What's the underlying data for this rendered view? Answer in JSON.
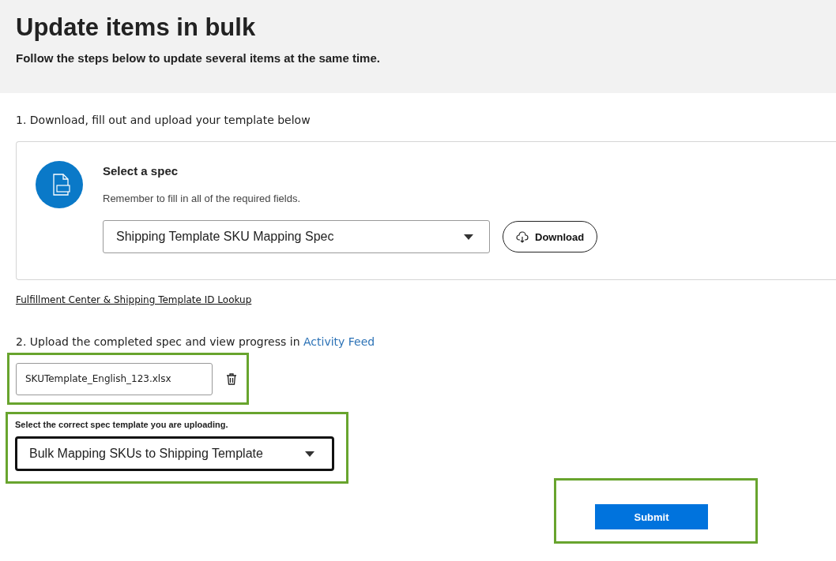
{
  "header": {
    "title": "Update items in bulk",
    "subtitle": "Follow the steps below to update several items at the same time."
  },
  "step1": {
    "label": "1. Download, fill out and upload your template below",
    "card": {
      "title": "Select a spec",
      "hint": "Remember to fill in all of the required fields.",
      "select_value": "Shipping Template SKU Mapping Spec",
      "download_button": "Download"
    },
    "link": "Fulfillment Center & Shipping Template ID Lookup"
  },
  "step2": {
    "label": "2. Upload the completed spec and view progress in",
    "link": "Activity Feed",
    "file_name": "SKUTemplate_English_123.xlsx",
    "template_label": "Select the correct spec template you are uploading.",
    "template_value": "Bulk Mapping SKUs to Shipping Template"
  },
  "submit_button": "Submit"
}
